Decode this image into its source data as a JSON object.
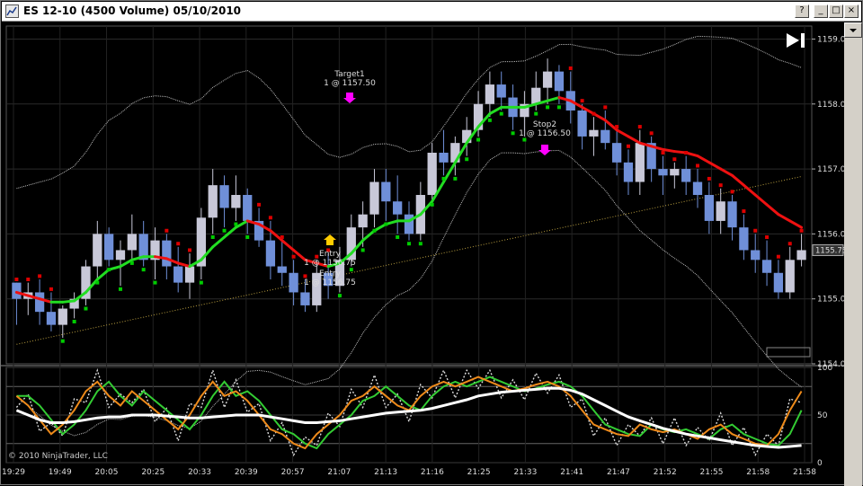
{
  "window": {
    "title": "ES 12-10 (4500 Volume)  05/10/2010",
    "buttons": [
      "?",
      "_",
      "□",
      "×"
    ]
  },
  "icons": {
    "app": "chart-app-icon",
    "play": "skip-forward-icon"
  },
  "colors": {
    "background": "#000000",
    "candle_up": "#c8c8d8",
    "candle_down": "#6f8fd8",
    "ma_green": "#22dd22",
    "ma_red": "#ee1111",
    "trail_green": "#00cc00",
    "trail_red": "#dd0000",
    "stoch_green": "#33cc33",
    "stoch_orange": "#ee8a1a",
    "stoch_white": "#ffffff",
    "entry_arrow": "#ffcc00",
    "target_arrow": "#ff00ff"
  },
  "price_axis": {
    "ticks": [
      "1159.00",
      "1158.00",
      "1157.00",
      "1156.00",
      "1155.00",
      "1154.00"
    ],
    "last_price": "1155.75"
  },
  "osc_axis": {
    "ticks": [
      "100",
      "50",
      "0"
    ]
  },
  "time_axis": {
    "ticks": [
      "19:29",
      "19:49",
      "20:05",
      "20:25",
      "20:33",
      "20:39",
      "20:57",
      "21:07",
      "21:13",
      "21:16",
      "21:25",
      "21:33",
      "21:41",
      "21:47",
      "21:52",
      "21:55",
      "21:58",
      "21:58"
    ]
  },
  "annotations": {
    "target": {
      "line1": "Target1",
      "line2": "1 @ 1157.50"
    },
    "stop": {
      "line1": "Stop2",
      "line2": "1 @ 1156.50"
    },
    "entry1": {
      "line1": "Entry",
      "line2": "1 @ 1156.75"
    },
    "entry2": {
      "line1": "Entry",
      "line2": "1 @ 1156.75"
    }
  },
  "copyright": "© 2010 NinjaTrader, LLC",
  "chart_data": {
    "type": "candlestick",
    "instrument": "ES 12-10",
    "bar_type": "4500 Volume",
    "date": "05/10/2010",
    "price_ylim": [
      1154.0,
      1159.2
    ],
    "osc_ylim": [
      0,
      100
    ],
    "bars": [
      [
        1155.25,
        1155.25,
        1154.6,
        1155.0
      ],
      [
        1155.0,
        1155.25,
        1154.75,
        1155.1
      ],
      [
        1155.1,
        1155.3,
        1154.6,
        1154.8
      ],
      [
        1154.8,
        1155.1,
        1154.5,
        1154.6
      ],
      [
        1154.6,
        1154.9,
        1154.4,
        1154.85
      ],
      [
        1154.85,
        1155.1,
        1154.7,
        1155.0
      ],
      [
        1155.0,
        1155.6,
        1154.9,
        1155.5
      ],
      [
        1155.5,
        1156.2,
        1155.3,
        1156.0
      ],
      [
        1156.0,
        1156.1,
        1155.5,
        1155.6
      ],
      [
        1155.6,
        1155.9,
        1155.2,
        1155.75
      ],
      [
        1155.75,
        1156.3,
        1155.6,
        1156.0
      ],
      [
        1156.0,
        1156.2,
        1155.5,
        1155.6
      ],
      [
        1155.6,
        1156.1,
        1155.3,
        1155.9
      ],
      [
        1155.9,
        1156.0,
        1155.3,
        1155.5
      ],
      [
        1155.5,
        1155.8,
        1155.1,
        1155.25
      ],
      [
        1155.25,
        1155.7,
        1155.0,
        1155.5
      ],
      [
        1155.5,
        1156.4,
        1155.3,
        1156.25
      ],
      [
        1156.25,
        1157.0,
        1156.0,
        1156.75
      ],
      [
        1156.75,
        1156.9,
        1156.1,
        1156.4
      ],
      [
        1156.4,
        1156.9,
        1156.2,
        1156.6
      ],
      [
        1156.6,
        1156.7,
        1156.0,
        1156.2
      ],
      [
        1156.2,
        1156.4,
        1155.8,
        1155.9
      ],
      [
        1155.9,
        1156.2,
        1155.3,
        1155.5
      ],
      [
        1155.5,
        1155.9,
        1155.2,
        1155.4
      ],
      [
        1155.4,
        1155.6,
        1154.9,
        1155.1
      ],
      [
        1155.1,
        1155.3,
        1154.8,
        1154.9
      ],
      [
        1154.9,
        1155.6,
        1154.8,
        1155.4
      ],
      [
        1155.4,
        1155.7,
        1155.0,
        1155.2
      ],
      [
        1155.2,
        1155.8,
        1155.1,
        1155.6
      ],
      [
        1155.6,
        1156.3,
        1155.5,
        1156.1
      ],
      [
        1156.1,
        1156.5,
        1155.8,
        1156.3
      ],
      [
        1156.3,
        1157.0,
        1156.1,
        1156.8
      ],
      [
        1156.8,
        1157.0,
        1156.2,
        1156.5
      ],
      [
        1156.5,
        1156.9,
        1156.0,
        1156.3
      ],
      [
        1156.3,
        1156.5,
        1155.9,
        1156.0
      ],
      [
        1156.0,
        1156.8,
        1155.9,
        1156.6
      ],
      [
        1156.6,
        1157.4,
        1156.5,
        1157.25
      ],
      [
        1157.25,
        1157.6,
        1156.9,
        1157.1
      ],
      [
        1157.1,
        1157.5,
        1156.9,
        1157.4
      ],
      [
        1157.4,
        1157.8,
        1157.2,
        1157.6
      ],
      [
        1157.6,
        1158.2,
        1157.5,
        1158.0
      ],
      [
        1158.0,
        1158.5,
        1157.8,
        1158.3
      ],
      [
        1158.3,
        1158.5,
        1157.9,
        1158.1
      ],
      [
        1158.1,
        1158.3,
        1157.6,
        1157.8
      ],
      [
        1157.8,
        1158.2,
        1157.5,
        1158.0
      ],
      [
        1158.0,
        1158.5,
        1157.9,
        1158.25
      ],
      [
        1158.25,
        1158.7,
        1158.0,
        1158.5
      ],
      [
        1158.5,
        1158.6,
        1158.0,
        1158.2
      ],
      [
        1158.2,
        1158.5,
        1157.7,
        1157.9
      ],
      [
        1157.9,
        1158.0,
        1157.3,
        1157.5
      ],
      [
        1157.5,
        1157.8,
        1157.2,
        1157.6
      ],
      [
        1157.6,
        1157.9,
        1157.3,
        1157.4
      ],
      [
        1157.4,
        1157.6,
        1156.9,
        1157.1
      ],
      [
        1157.1,
        1157.3,
        1156.6,
        1156.8
      ],
      [
        1156.8,
        1157.6,
        1156.6,
        1157.4
      ],
      [
        1157.4,
        1157.5,
        1156.8,
        1157.0
      ],
      [
        1157.0,
        1157.2,
        1156.6,
        1156.9
      ],
      [
        1156.9,
        1157.1,
        1156.7,
        1157.0
      ],
      [
        1157.0,
        1157.2,
        1156.6,
        1156.8
      ],
      [
        1156.8,
        1157.0,
        1156.4,
        1156.6
      ],
      [
        1156.6,
        1156.8,
        1156.0,
        1156.2
      ],
      [
        1156.2,
        1156.7,
        1156.0,
        1156.5
      ],
      [
        1156.5,
        1156.6,
        1155.9,
        1156.1
      ],
      [
        1156.1,
        1156.3,
        1155.6,
        1155.75
      ],
      [
        1155.75,
        1156.0,
        1155.4,
        1155.6
      ],
      [
        1155.6,
        1155.9,
        1155.2,
        1155.4
      ],
      [
        1155.4,
        1155.6,
        1155.0,
        1155.1
      ],
      [
        1155.1,
        1155.8,
        1155.0,
        1155.6
      ],
      [
        1155.6,
        1156.0,
        1155.5,
        1155.75
      ]
    ],
    "series": [
      {
        "name": "ma_fast",
        "values": [
          1155.1,
          1155.05,
          1155.0,
          1154.95,
          1154.95,
          1154.97,
          1155.1,
          1155.3,
          1155.45,
          1155.5,
          1155.6,
          1155.65,
          1155.65,
          1155.62,
          1155.55,
          1155.5,
          1155.6,
          1155.8,
          1155.95,
          1156.1,
          1156.2,
          1156.15,
          1156.05,
          1155.9,
          1155.75,
          1155.6,
          1155.55,
          1155.5,
          1155.55,
          1155.7,
          1155.9,
          1156.05,
          1156.15,
          1156.2,
          1156.2,
          1156.3,
          1156.5,
          1156.8,
          1157.1,
          1157.4,
          1157.65,
          1157.85,
          1157.95,
          1157.95,
          1157.95,
          1158.0,
          1158.05,
          1158.1,
          1158.05,
          1157.95,
          1157.85,
          1157.75,
          1157.6,
          1157.5,
          1157.4,
          1157.35,
          1157.3,
          1157.27,
          1157.25,
          1157.2,
          1157.1,
          1157.0,
          1156.9,
          1156.75,
          1156.6,
          1156.45,
          1156.3,
          1156.2,
          1156.1
        ]
      },
      {
        "name": "oscillator",
        "values": [
          70,
          60,
          45,
          30,
          40,
          55,
          75,
          85,
          70,
          60,
          75,
          65,
          55,
          45,
          35,
          50,
          70,
          85,
          70,
          75,
          65,
          50,
          35,
          30,
          20,
          15,
          30,
          40,
          50,
          65,
          70,
          80,
          70,
          60,
          55,
          70,
          80,
          85,
          80,
          85,
          90,
          85,
          80,
          75,
          78,
          82,
          85,
          80,
          70,
          55,
          40,
          35,
          30,
          28,
          40,
          35,
          32,
          35,
          30,
          25,
          35,
          40,
          30,
          25,
          20,
          18,
          30,
          55,
          75
        ]
      },
      {
        "name": "oscillator_slow",
        "values": [
          55,
          50,
          45,
          42,
          42,
          43,
          45,
          47,
          48,
          48,
          50,
          50,
          50,
          49,
          48,
          47,
          47,
          48,
          49,
          50,
          50,
          50,
          48,
          46,
          44,
          42,
          42,
          43,
          44,
          46,
          48,
          50,
          52,
          53,
          54,
          55,
          57,
          60,
          63,
          66,
          70,
          72,
          74,
          75,
          76,
          77,
          78,
          78,
          76,
          72,
          66,
          60,
          54,
          48,
          44,
          40,
          36,
          33,
          30,
          28,
          26,
          24,
          22,
          20,
          18,
          17,
          16,
          17,
          18
        ]
      }
    ]
  }
}
